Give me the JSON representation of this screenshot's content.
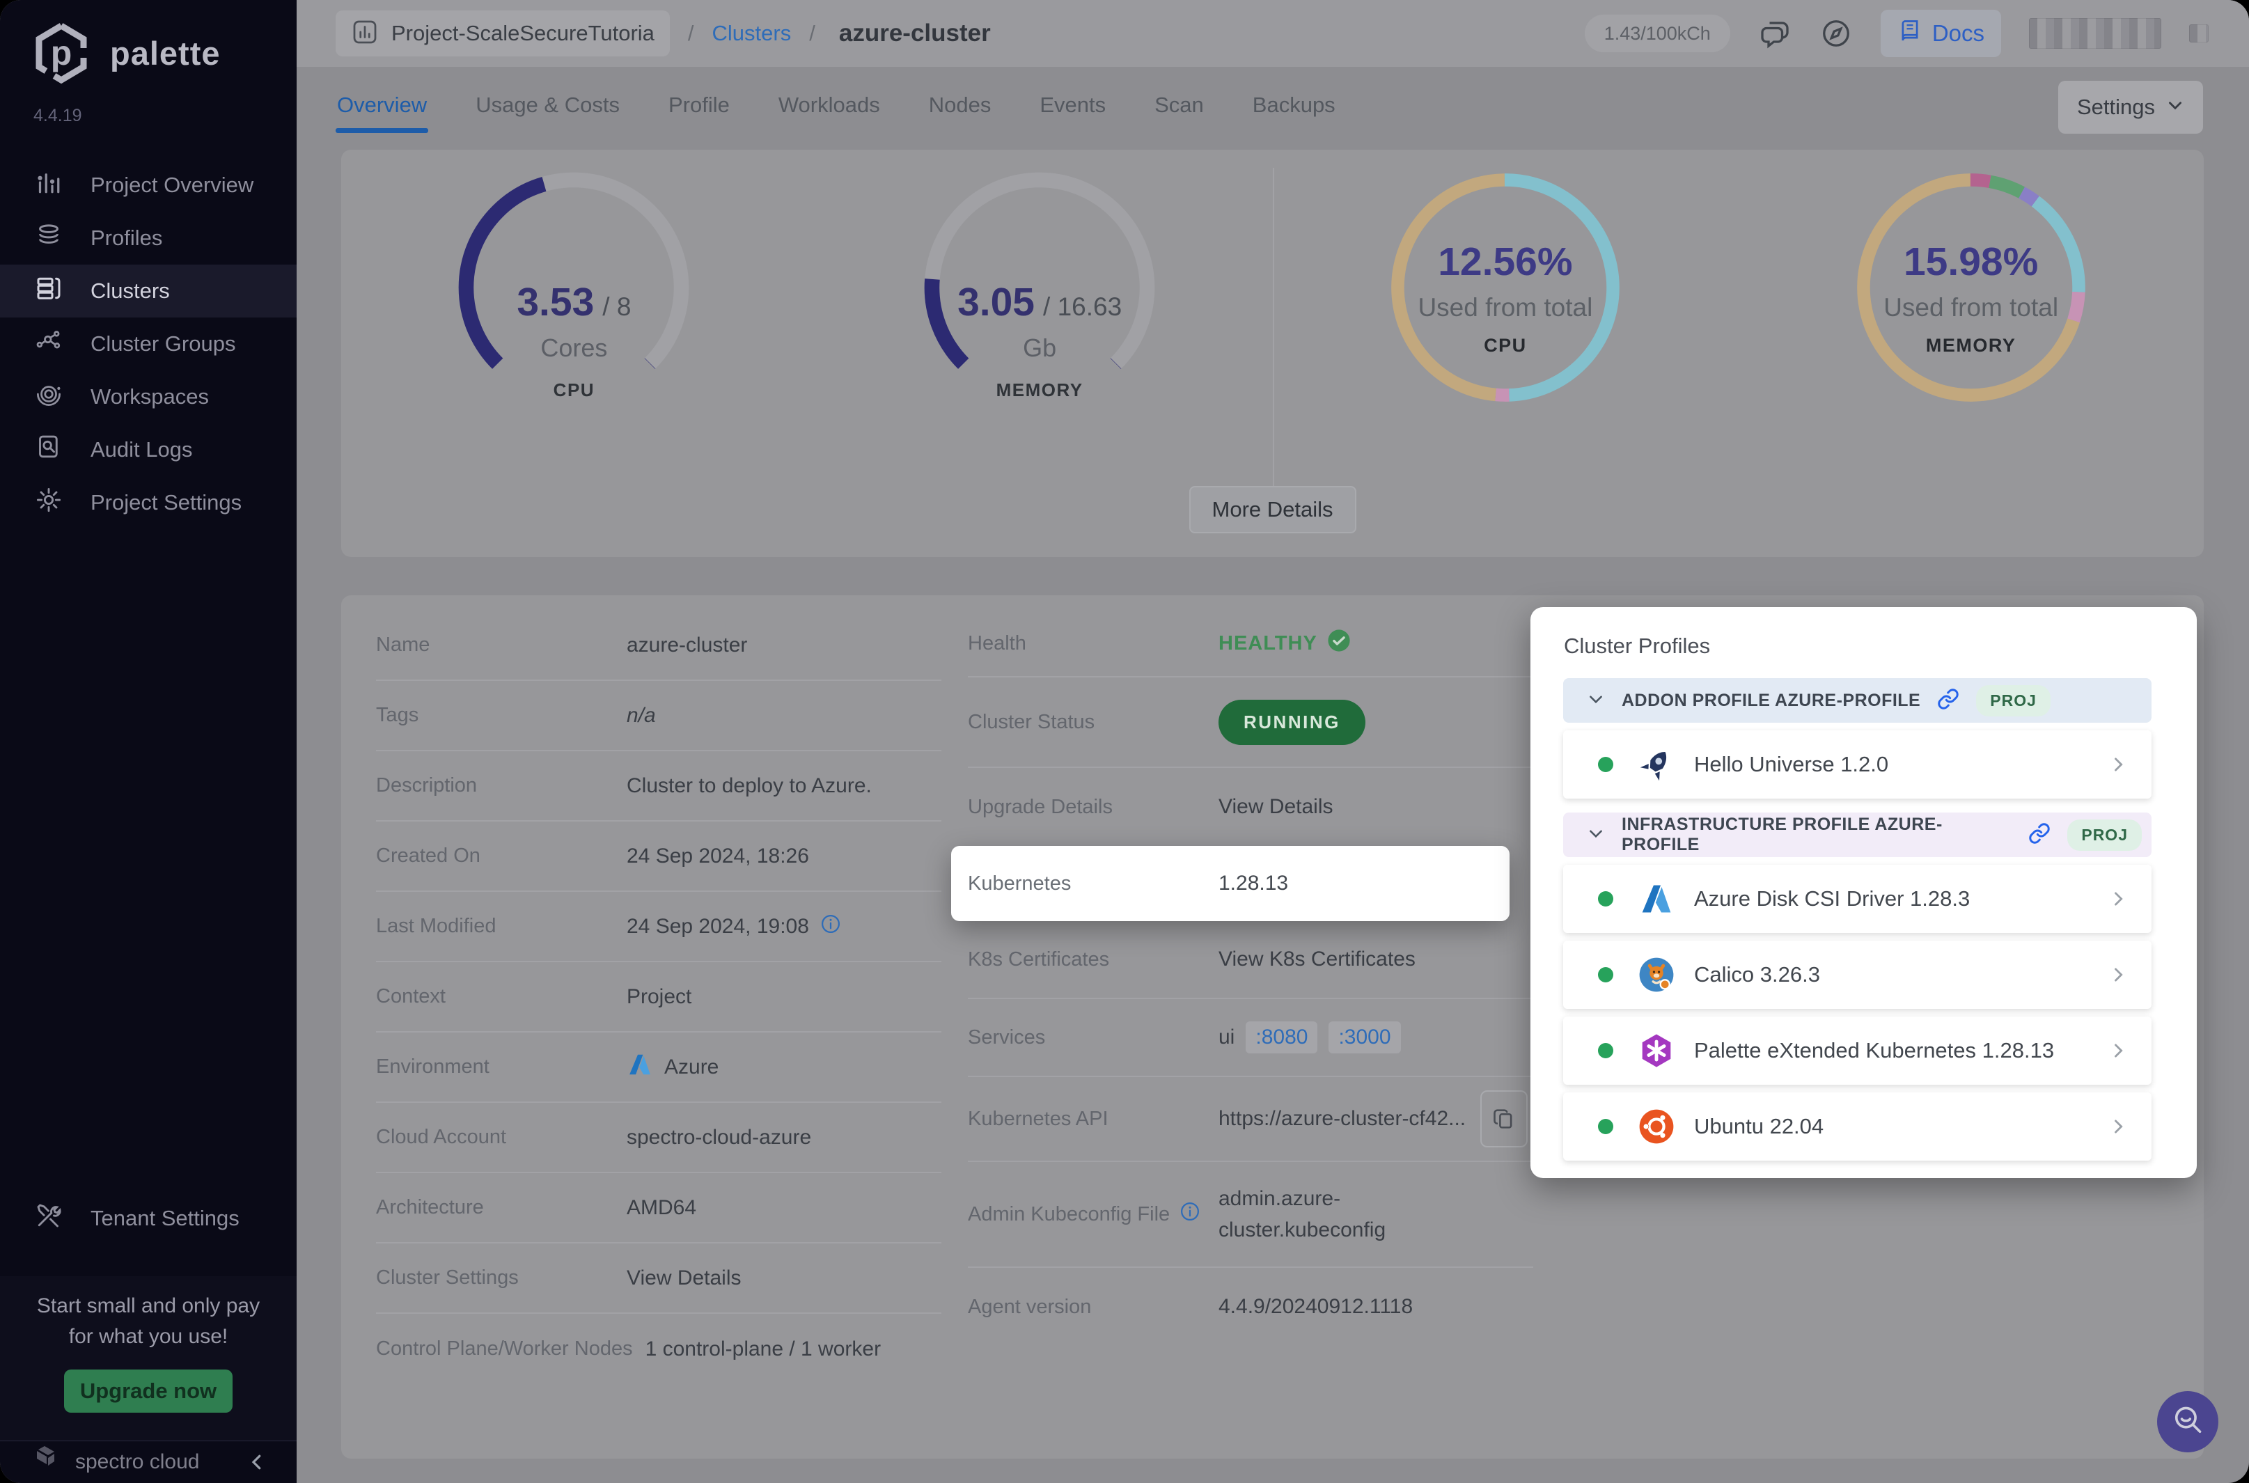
{
  "app": {
    "brand": "palette",
    "version": "4.4.19",
    "footer_brand": "spectro cloud"
  },
  "sidebar": {
    "items": [
      {
        "label": "Project Overview"
      },
      {
        "label": "Profiles"
      },
      {
        "label": "Clusters"
      },
      {
        "label": "Cluster Groups"
      },
      {
        "label": "Workspaces"
      },
      {
        "label": "Audit Logs"
      },
      {
        "label": "Project Settings"
      }
    ],
    "tenant_label": "Tenant Settings",
    "promo": {
      "line1": "Start small and only pay",
      "line2": "for what you use!",
      "cta": "Upgrade now"
    }
  },
  "header": {
    "project": "Project-ScaleSecureTutoria",
    "sep": "/",
    "crumb_link": "Clusters",
    "crumb_current": "azure-cluster",
    "credits": "1.43/100kCh",
    "docs_label": "Docs"
  },
  "tabs": {
    "items": [
      {
        "label": "Overview"
      },
      {
        "label": "Usage & Costs"
      },
      {
        "label": "Profile"
      },
      {
        "label": "Workloads"
      },
      {
        "label": "Nodes"
      },
      {
        "label": "Events"
      },
      {
        "label": "Scan"
      },
      {
        "label": "Backups"
      }
    ],
    "settings_label": "Settings"
  },
  "more_details_label": "More Details",
  "chart_data": [
    {
      "type": "gauge",
      "label": "CPU",
      "value": 3.53,
      "capacity": 8,
      "value_label": "3.53",
      "capacity_label": "/ 8",
      "unit": "Cores",
      "color": "#2c2a72",
      "arc_degrees": 270
    },
    {
      "type": "gauge",
      "label": "MEMORY",
      "value": 3.05,
      "capacity": 16.63,
      "value_label": "3.05",
      "capacity_label": "/ 16.63",
      "unit": "Gb",
      "color": "#2c2a72",
      "arc_degrees": 270
    },
    {
      "type": "donut",
      "label": "CPU",
      "center_label": "12.56%",
      "caption": "Used from total",
      "segments": [
        {
          "name": "teal",
          "color": "#83c0cd",
          "pct": 49.5
        },
        {
          "name": "pink",
          "color": "#c793b5",
          "pct": 2.0
        },
        {
          "name": "tan",
          "color": "#c2a87e",
          "pct": 48.5
        }
      ]
    },
    {
      "type": "donut",
      "label": "MEMORY",
      "center_label": "15.98%",
      "caption": "Used from total",
      "segments": [
        {
          "name": "magenta",
          "color": "#b4638f",
          "pct": 2.8
        },
        {
          "name": "green",
          "color": "#5fa172",
          "pct": 5.0
        },
        {
          "name": "purple",
          "color": "#8a7fc6",
          "pct": 2.4
        },
        {
          "name": "teal",
          "color": "#83c0cd",
          "pct": 15.5
        },
        {
          "name": "pink",
          "color": "#c793b5",
          "pct": 4.3
        },
        {
          "name": "tan",
          "color": "#c2a87e",
          "pct": 70.0
        }
      ]
    }
  ],
  "details": {
    "left": {
      "name_label": "Name",
      "name": "azure-cluster",
      "tags_label": "Tags",
      "tags": "n/a",
      "desc_label": "Description",
      "desc": "Cluster to deploy to Azure.",
      "created_label": "Created On",
      "created": "24 Sep 2024, 18:26",
      "modified_label": "Last Modified",
      "modified": "24 Sep 2024, 19:08",
      "context_label": "Context",
      "context": "Project",
      "env_label": "Environment",
      "env": "Azure",
      "account_label": "Cloud Account",
      "account": "spectro-cloud-azure",
      "arch_label": "Architecture",
      "arch": "AMD64",
      "settings_label": "Cluster Settings",
      "settings_link": "View Details",
      "nodes_label": "Control Plane/Worker Nodes",
      "nodes": "1 control-plane / 1 worker"
    },
    "right": {
      "health_label": "Health",
      "health": "HEALTHY",
      "status_label": "Cluster Status",
      "status": "RUNNING",
      "upgrade_label": "Upgrade Details",
      "upgrade_link": "View Details",
      "k8s_label": "Kubernetes",
      "k8s_version": "1.28.13",
      "certs_label": "K8s Certificates",
      "certs_link": "View K8s Certificates",
      "services_label": "Services",
      "services_prefix": "ui",
      "port1": ":8080",
      "port2": ":3000",
      "api_label": "Kubernetes API",
      "api_value": "https://azure-cluster-cf42...",
      "kubeconfig_label": "Admin Kubeconfig File",
      "kubeconfig_line1": "admin.azure-",
      "kubeconfig_line2": "cluster.kubeconfig",
      "agent_label": "Agent version",
      "agent": "4.4.9/20240912.1118"
    }
  },
  "profiles_panel": {
    "title": "Cluster Profiles",
    "groups": [
      {
        "header": "ADDON PROFILE AZURE-PROFILE",
        "badge": "PROJ",
        "items": [
          {
            "name": "Hello Universe 1.2.0"
          }
        ]
      },
      {
        "header": "INFRASTRUCTURE PROFILE AZURE-PROFILE",
        "badge": "PROJ",
        "items": [
          {
            "name": "Azure Disk CSI Driver 1.28.3"
          },
          {
            "name": "Calico 3.26.3"
          },
          {
            "name": "Palette eXtended Kubernetes 1.28.13"
          },
          {
            "name": "Ubuntu 22.04"
          }
        ]
      }
    ]
  },
  "colors": {
    "accent_blue": "#1d5ca9",
    "link_blue": "#2e6cb8",
    "gauge_indigo": "#2c2a72",
    "healthy_green": "#3f8d55",
    "running_green": "#206b3a",
    "upgrade_green": "#2f7e50",
    "dot_green": "#27a25b",
    "sidebar_bg": "#0a0a17",
    "spotlight_white": "#ffffff"
  }
}
